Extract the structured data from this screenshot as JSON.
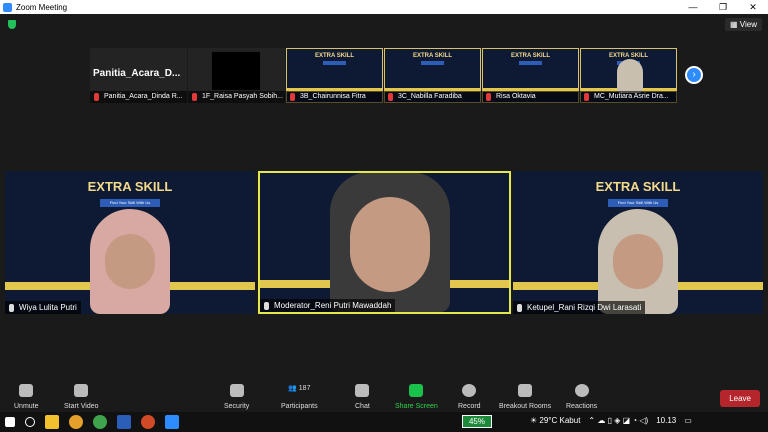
{
  "window": {
    "title": "Zoom Meeting",
    "controls": [
      "—",
      "❐",
      "✕"
    ]
  },
  "view_label": "View",
  "poster": {
    "title": "EXTRA SKILL",
    "subtitle": "Find Your Skill With Us"
  },
  "strip": [
    {
      "name": "Panitia_Acara_Dinda R...",
      "big": "Panitia_Acara_D...",
      "type": "name"
    },
    {
      "name": "1F_Raisa Pasyah Sobih...",
      "type": "black"
    },
    {
      "name": "3B_Chairunnisa Fitra",
      "type": "poster"
    },
    {
      "name": "3C_Nabilla Faradiba",
      "type": "poster"
    },
    {
      "name": "Risa Oktavia",
      "type": "poster"
    },
    {
      "name": "MC_Mutiara Asrie Dra...",
      "type": "poster"
    }
  ],
  "main": [
    {
      "name": "Wiya Lulita Putri"
    },
    {
      "name": "Moderator_Reni Putri Mawaddah"
    },
    {
      "name": "Ketupel_Rani Rizqi Dwi Larasati"
    }
  ],
  "toolbar": {
    "unmute": "Unmute",
    "start_video": "Start Video",
    "security": "Security",
    "participants": "Participants",
    "participants_count": "187",
    "chat": "Chat",
    "share_screen": "Share Screen",
    "record": "Record",
    "breakout": "Breakout Rooms",
    "reactions": "Reactions",
    "leave": "Leave"
  },
  "taskbar": {
    "battery": "45%",
    "weather": "29°C  Kabut",
    "time": "10.13"
  },
  "colors": {
    "accent": "#2d8cff",
    "leave": "#b5252c",
    "share": "#18c24b",
    "active_border": "#e5e84d"
  }
}
